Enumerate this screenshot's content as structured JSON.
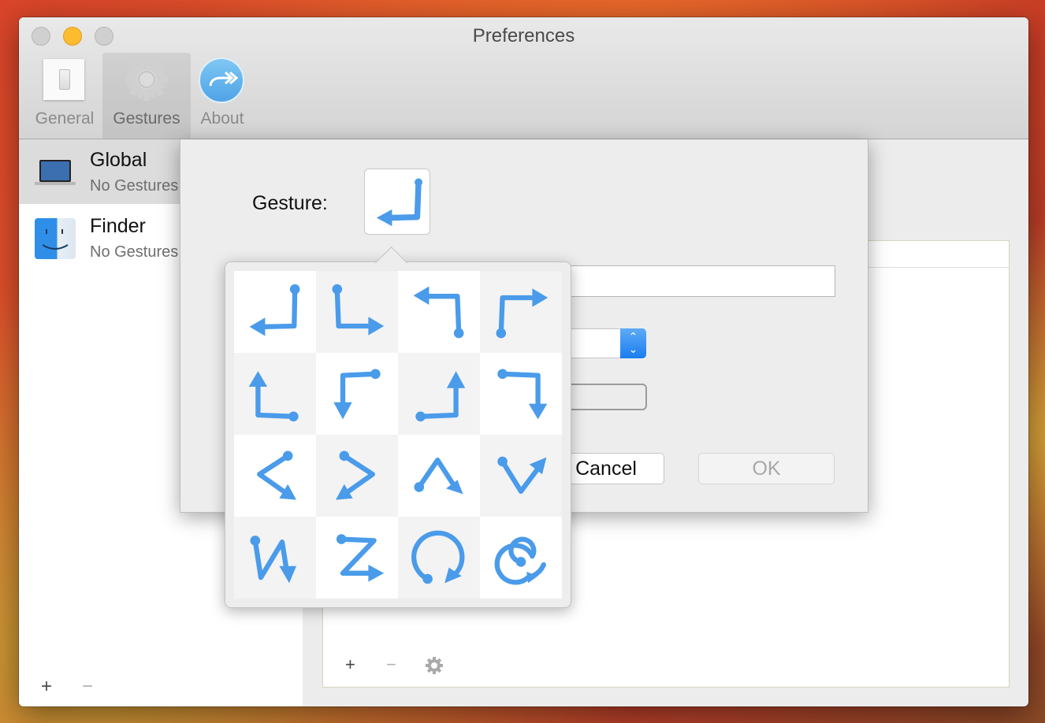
{
  "window": {
    "title": "Preferences",
    "traffic_lights": [
      "close",
      "minimize",
      "zoom"
    ]
  },
  "toolbar": {
    "items": [
      {
        "label": "General",
        "icon": "switch-icon",
        "selected": false
      },
      {
        "label": "Gestures",
        "icon": "gear-icon",
        "selected": true
      },
      {
        "label": "About",
        "icon": "forward-arrow-icon",
        "selected": false
      }
    ]
  },
  "sidebar": {
    "items": [
      {
        "title": "Global",
        "subtitle": "No Gestures",
        "icon": "laptop-icon",
        "selected": true
      },
      {
        "title": "Finder",
        "subtitle": "No Gestures",
        "icon": "finder-icon",
        "selected": false
      }
    ],
    "footer": {
      "add": "+",
      "remove": "−"
    }
  },
  "right_pane": {
    "footer": {
      "add": "+",
      "remove": "−",
      "settings": "gear-icon"
    }
  },
  "sheet": {
    "gesture_label": "Gesture:",
    "selected_gesture": "down-left-hook",
    "name_field_value": "",
    "key_field_partial": ":",
    "cancel_label": "Cancel",
    "ok_label": "OK",
    "ok_enabled": false
  },
  "gesture_popover": {
    "accent": "#4a9bea",
    "gestures": [
      "down-then-left",
      "down-then-right",
      "up-then-left",
      "up-then-right",
      "left-then-up",
      "left-then-down",
      "right-then-up",
      "right-then-down",
      "chevron-left",
      "chevron-right",
      "caret-up",
      "check-v",
      "n-zigzag",
      "z-zigzag",
      "circle-clockwise",
      "spiral-clockwise"
    ]
  }
}
